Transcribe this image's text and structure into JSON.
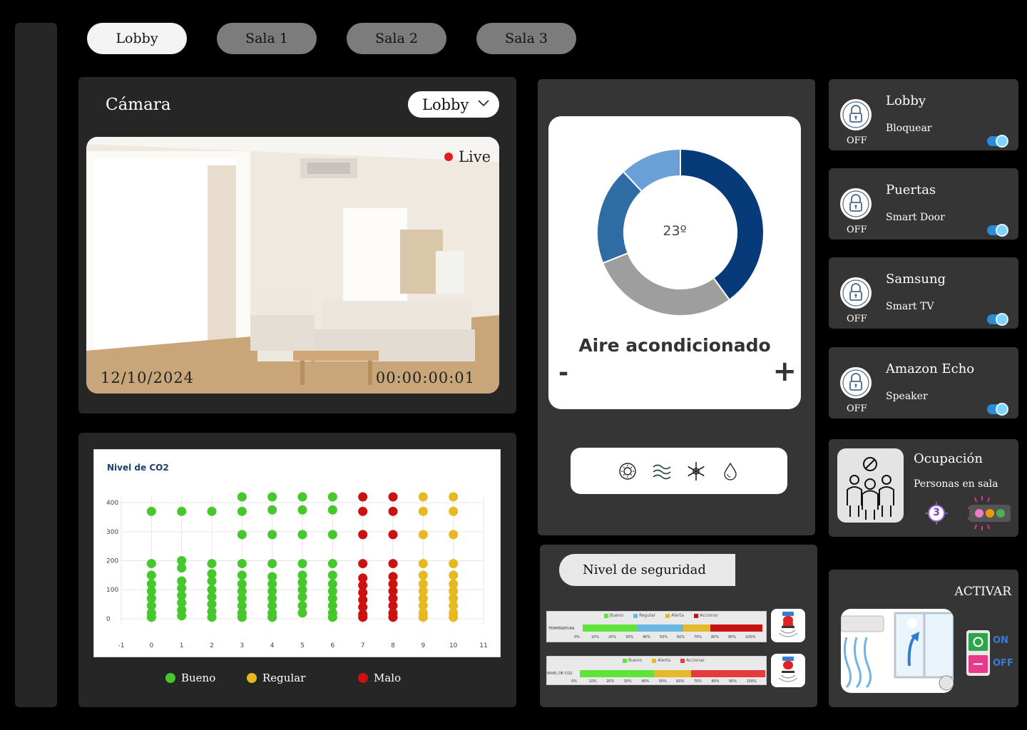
{
  "tabs": [
    {
      "label": "Lobby",
      "active": true
    },
    {
      "label": "Sala 1",
      "active": false
    },
    {
      "label": "Sala 2",
      "active": false
    },
    {
      "label": "Sala 3",
      "active": false
    }
  ],
  "camera": {
    "title": "Cámara",
    "selected_room": "Lobby",
    "live_label": "Live",
    "date": "12/10/2024",
    "time": "00:00:00:01"
  },
  "chart_data": {
    "type": "scatter",
    "title": "Nivel de CO2",
    "xlabel": "",
    "ylabel": "",
    "x_ticks": [
      "-1",
      "0",
      "1",
      "2",
      "3",
      "4",
      "5",
      "6",
      "7",
      "8",
      "9",
      "10",
      "11"
    ],
    "y_ticks": [
      "0",
      "100",
      "200",
      "300",
      "400"
    ],
    "xlim": [
      -1,
      11
    ],
    "ylim": [
      -20,
      420
    ],
    "grid": true,
    "legend_position": "bottom",
    "series": [
      {
        "name": "Bueno",
        "color": "#46c82d",
        "points": [
          [
            0,
            370
          ],
          [
            0,
            190
          ],
          [
            0,
            150
          ],
          [
            0,
            120
          ],
          [
            0,
            95
          ],
          [
            0,
            70
          ],
          [
            0,
            45
          ],
          [
            0,
            20
          ],
          [
            0,
            5
          ],
          [
            1,
            370
          ],
          [
            1,
            200
          ],
          [
            1,
            175
          ],
          [
            1,
            130
          ],
          [
            1,
            105
          ],
          [
            1,
            80
          ],
          [
            1,
            55
          ],
          [
            1,
            30
          ],
          [
            1,
            10
          ],
          [
            2,
            370
          ],
          [
            2,
            190
          ],
          [
            2,
            155
          ],
          [
            2,
            130
          ],
          [
            2,
            100
          ],
          [
            2,
            75
          ],
          [
            2,
            50
          ],
          [
            2,
            25
          ],
          [
            2,
            5
          ],
          [
            3,
            420
          ],
          [
            3,
            370
          ],
          [
            3,
            290
          ],
          [
            3,
            190
          ],
          [
            3,
            150
          ],
          [
            3,
            120
          ],
          [
            3,
            95
          ],
          [
            3,
            70
          ],
          [
            3,
            45
          ],
          [
            3,
            20
          ],
          [
            3,
            5
          ],
          [
            4,
            420
          ],
          [
            4,
            375
          ],
          [
            4,
            290
          ],
          [
            4,
            190
          ],
          [
            4,
            145
          ],
          [
            4,
            120
          ],
          [
            4,
            95
          ],
          [
            4,
            70
          ],
          [
            4,
            45
          ],
          [
            4,
            20
          ],
          [
            4,
            5
          ],
          [
            5,
            420
          ],
          [
            5,
            375
          ],
          [
            5,
            290
          ],
          [
            5,
            190
          ],
          [
            5,
            150
          ],
          [
            5,
            125
          ],
          [
            5,
            100
          ],
          [
            5,
            75
          ],
          [
            5,
            45
          ],
          [
            5,
            20
          ],
          [
            6,
            420
          ],
          [
            6,
            375
          ],
          [
            6,
            290
          ],
          [
            6,
            190
          ],
          [
            6,
            150
          ],
          [
            6,
            120
          ],
          [
            6,
            95
          ],
          [
            6,
            70
          ],
          [
            6,
            45
          ],
          [
            6,
            20
          ],
          [
            6,
            5
          ]
        ]
      },
      {
        "name": "Regular",
        "color": "#e6b91e",
        "points": [
          [
            9,
            420
          ],
          [
            9,
            370
          ],
          [
            9,
            290
          ],
          [
            9,
            190
          ],
          [
            9,
            150
          ],
          [
            9,
            120
          ],
          [
            9,
            95
          ],
          [
            9,
            70
          ],
          [
            9,
            45
          ],
          [
            9,
            20
          ],
          [
            9,
            5
          ],
          [
            10,
            420
          ],
          [
            10,
            370
          ],
          [
            10,
            290
          ],
          [
            10,
            190
          ],
          [
            10,
            150
          ],
          [
            10,
            120
          ],
          [
            10,
            95
          ],
          [
            10,
            70
          ],
          [
            10,
            45
          ],
          [
            10,
            20
          ],
          [
            10,
            5
          ]
        ]
      },
      {
        "name": "Malo",
        "color": "#cc1111",
        "points": [
          [
            7,
            420
          ],
          [
            7,
            370
          ],
          [
            7,
            290
          ],
          [
            7,
            190
          ],
          [
            7,
            140
          ],
          [
            7,
            115
          ],
          [
            7,
            90
          ],
          [
            7,
            65
          ],
          [
            7,
            40
          ],
          [
            7,
            15
          ],
          [
            7,
            5
          ],
          [
            8,
            420
          ],
          [
            8,
            370
          ],
          [
            8,
            290
          ],
          [
            8,
            190
          ],
          [
            8,
            145
          ],
          [
            8,
            120
          ],
          [
            8,
            95
          ],
          [
            8,
            70
          ],
          [
            8,
            45
          ],
          [
            8,
            20
          ],
          [
            8,
            5
          ]
        ]
      }
    ]
  },
  "ac": {
    "temperature": "23º",
    "title": "Aire acondicionado",
    "minus": "-",
    "plus": "+",
    "donut_segments": [
      {
        "value": 40,
        "color": "#063a78"
      },
      {
        "value": 29,
        "color": "#9e9e9e"
      },
      {
        "value": 19,
        "color": "#2f6ca3"
      },
      {
        "value": 12,
        "color": "#6aa0d6"
      }
    ],
    "modes": [
      "sun-icon",
      "wind-icon",
      "snowflake-icon",
      "droplet-icon"
    ]
  },
  "security": {
    "label": "Nivel de seguridad",
    "temp_bar": {
      "category": "TEMPERATURA",
      "legend": [
        {
          "name": "Bueno",
          "color": "#5ee43a"
        },
        {
          "name": "Regular",
          "color": "#6ab7e3"
        },
        {
          "name": "Alerta",
          "color": "#e6b82e"
        },
        {
          "name": "Accionar",
          "color": "#c81313"
        }
      ],
      "segments": [
        30,
        26,
        15,
        29
      ],
      "ticks": [
        "0%",
        "10%",
        "20%",
        "30%",
        "40%",
        "50%",
        "60%",
        "70%",
        "80%",
        "90%",
        "100%"
      ]
    },
    "co2_bar": {
      "category": "NIVEL DE CO2",
      "legend": [
        {
          "name": "Bueno",
          "color": "#5ee43a"
        },
        {
          "name": "Alerta",
          "color": "#e6b82e"
        },
        {
          "name": "Accionar",
          "color": "#e43c3c"
        }
      ],
      "segments": [
        40,
        20,
        40
      ],
      "ticks": [
        "0%",
        "10%",
        "20%",
        "30%",
        "40%",
        "50%",
        "60%",
        "70%",
        "80%",
        "90%",
        "100%"
      ]
    }
  },
  "devices": [
    {
      "name": "Lobby",
      "sub": "Bloquear",
      "state": "OFF"
    },
    {
      "name": "Puertas",
      "sub": "Smart Door",
      "state": "OFF"
    },
    {
      "name": "Samsung",
      "sub": "Smart TV",
      "state": "OFF"
    },
    {
      "name": "Amazon Echo",
      "sub": "Speaker",
      "state": "OFF"
    }
  ],
  "occupancy": {
    "title": "Ocupación",
    "sub": "Personas en sala",
    "count": "3"
  },
  "activate": {
    "title": "ACTIVAR",
    "on": "ON",
    "off": "OFF"
  }
}
